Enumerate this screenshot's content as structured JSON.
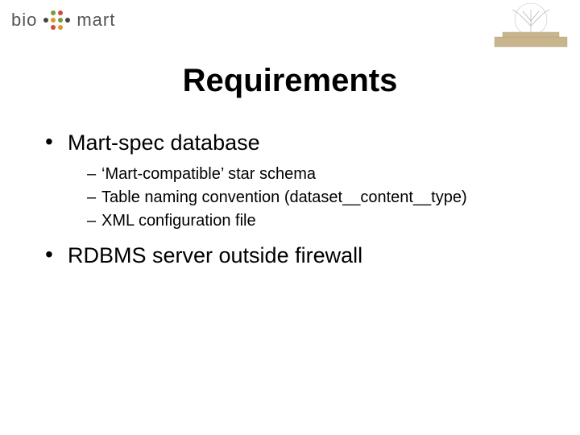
{
  "logo": {
    "prefix": "bio",
    "suffix": "mart"
  },
  "title": "Requirements",
  "bullets": [
    {
      "text": "Mart-spec database",
      "sub": [
        "‘Mart-compatible’ star schema",
        "Table naming convention (dataset__content__type)",
        " XML configuration file"
      ]
    },
    {
      "text": "RDBMS server outside firewall",
      "sub": []
    }
  ]
}
